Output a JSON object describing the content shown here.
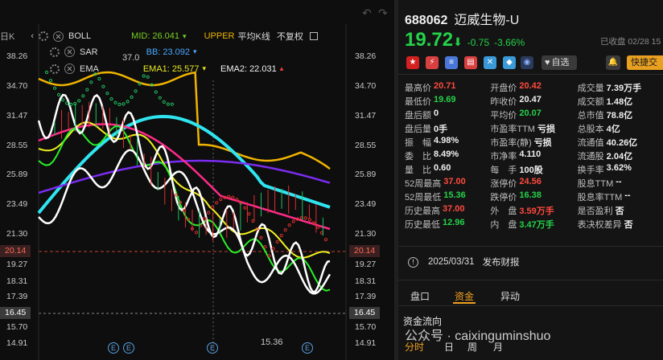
{
  "chart_toolbar": {
    "boll_label": "BOLL",
    "sar_label": "SAR",
    "ema_label": "EMA",
    "edge_label": "日K",
    "mid_label": "MID:",
    "mid_value": "26.041",
    "upper_label": "UPPER",
    "bb_label": "BB:",
    "bb_value": "23.092",
    "ema1_label": "EMA1:",
    "ema1_value": "25.577",
    "ema2_label": "EMA2:",
    "ema2_value": "22.031",
    "avg_k_label": "平均K线",
    "no_adjust_label": "不复权"
  },
  "chart": {
    "left_axis": [
      "38.26",
      "34.70",
      "31.47",
      "28.55",
      "25.89",
      "23.49",
      "21.30",
      "20.14",
      "19.27",
      "18.31",
      "17.39",
      "16.45",
      "15.70",
      "14.91"
    ],
    "right_axis": [
      "38.26",
      "34.70",
      "31.47",
      "28.55",
      "25.89",
      "23.49",
      "21.30",
      "20.14",
      "19.27",
      "18.31",
      "17.39",
      "16.45",
      "15.70",
      "14.91"
    ],
    "current_price_tag": "20.14",
    "low_price_tag": "16.45",
    "annotation_high": "37.0",
    "annotation_low": "15.36",
    "event_badge": "E",
    "colors": {
      "price_white": "#ffffff",
      "upper_band": "#f0b400",
      "ma_cyan": "#2fe5f0",
      "ma_purple": "#7a2cf0",
      "ma_pink": "#ff2a8a",
      "ma_yellow": "#f0f020",
      "ma_green": "#28f028",
      "sar_red": "#e03030",
      "sar_green": "#20c060"
    }
  },
  "quote": {
    "code": "688062",
    "name": "迈威生物-U",
    "price": "19.72",
    "arrow": "⬇",
    "change": "-0.75",
    "change_pct": "-3.66%",
    "status": "已收盘 02/28 15",
    "add_watch": "自选",
    "quick_trade": "快捷交",
    "rows": [
      [
        {
          "l": "最高价",
          "v": "20.71",
          "c": "red"
        },
        {
          "l": "开盘价",
          "v": "20.42",
          "c": "red"
        },
        {
          "l": "成交量",
          "v": "7.39万手",
          "c": "white"
        }
      ],
      [
        {
          "l": "最低价",
          "v": "19.69",
          "c": "green"
        },
        {
          "l": "昨收价",
          "v": "20.47",
          "c": "white"
        },
        {
          "l": "成交额",
          "v": "1.48亿",
          "c": "white"
        }
      ],
      [
        {
          "l": "盘后额",
          "v": "0",
          "c": "white"
        },
        {
          "l": "平均价",
          "v": "20.07",
          "c": "green"
        },
        {
          "l": "总市值",
          "v": "78.8亿",
          "c": "white"
        }
      ],
      [
        {
          "l": "盘后量",
          "v": "0手",
          "c": "white"
        },
        {
          "l": "市盈率TTM",
          "v": "亏损",
          "c": "white"
        },
        {
          "l": "总股本",
          "v": "4亿",
          "c": "white"
        }
      ],
      [
        {
          "l": "振　幅",
          "v": "4.98%",
          "c": "white"
        },
        {
          "l": "市盈率(静)",
          "v": "亏损",
          "c": "white"
        },
        {
          "l": "流通值",
          "v": "40.26亿",
          "c": "white"
        }
      ],
      [
        {
          "l": "委　比",
          "v": "8.49%",
          "c": "white"
        },
        {
          "l": "市净率",
          "v": "4.110",
          "c": "white"
        },
        {
          "l": "流通股",
          "v": "2.04亿",
          "c": "white"
        }
      ],
      [
        {
          "l": "量　比",
          "v": "0.60",
          "c": "white"
        },
        {
          "l": "每　手",
          "v": "100股",
          "c": "white"
        },
        {
          "l": "换手率",
          "v": "3.62%",
          "c": "white"
        }
      ],
      [
        {
          "l": "52周最高",
          "v": "37.00",
          "c": "red"
        },
        {
          "l": "涨停价",
          "v": "24.56",
          "c": "red"
        },
        {
          "l": "股息TTM",
          "v": "--",
          "c": "white"
        }
      ],
      [
        {
          "l": "52周最低",
          "v": "15.36",
          "c": "green"
        },
        {
          "l": "跌停价",
          "v": "16.38",
          "c": "green"
        },
        {
          "l": "股息率TTM",
          "v": "--",
          "c": "white"
        }
      ],
      [
        {
          "l": "历史最高",
          "v": "37.00",
          "c": "red"
        },
        {
          "l": "外　盘",
          "v": "3.59万手",
          "c": "red"
        },
        {
          "l": "是否盈利",
          "v": "否",
          "c": "white"
        }
      ],
      [
        {
          "l": "历史最低",
          "v": "12.96",
          "c": "green"
        },
        {
          "l": "内　盘",
          "v": "3.47万手",
          "c": "green"
        },
        {
          "l": "表决权差异",
          "v": "否",
          "c": "white"
        }
      ]
    ],
    "event_date": "2025/03/31",
    "event_text": "发布财报",
    "tabs": [
      "盘口",
      "资金",
      "异动"
    ],
    "fund_flow_title": "资金流向",
    "period_tabs": [
      "分时",
      "日",
      "周",
      "月"
    ],
    "watermark": "公众号 · caixinguminshuo"
  }
}
